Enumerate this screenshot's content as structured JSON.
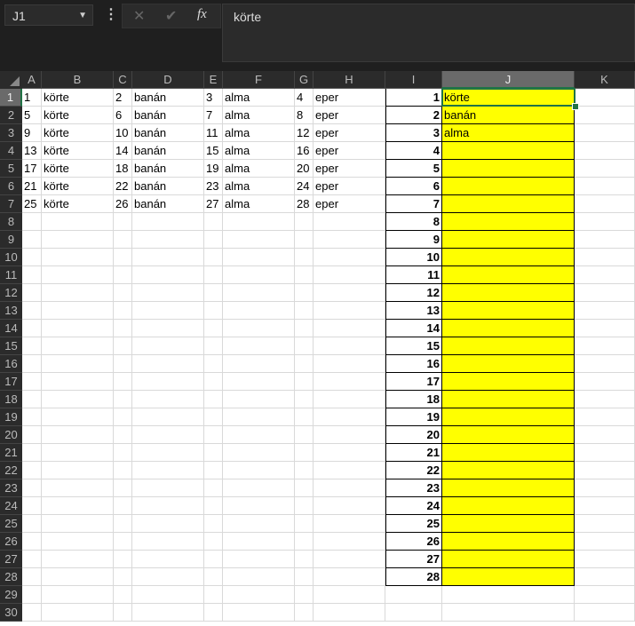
{
  "name_box": "J1",
  "formula": "körte",
  "formula_icons": [
    "cancel-icon",
    "enter-icon",
    "function-icon"
  ],
  "fx_label": "fx",
  "columns": [
    "A",
    "B",
    "C",
    "D",
    "E",
    "F",
    "G",
    "H",
    "I",
    "J",
    "K"
  ],
  "selected_column": "J",
  "selected_row": 1,
  "row_count": 30,
  "grid": [
    [
      "1",
      "körte",
      "2",
      "banán",
      "3",
      "alma",
      "4",
      "eper"
    ],
    [
      "5",
      "körte",
      "6",
      "banán",
      "7",
      "alma",
      "8",
      "eper"
    ],
    [
      "9",
      "körte",
      "10",
      "banán",
      "11",
      "alma",
      "12",
      "eper"
    ],
    [
      "13",
      "körte",
      "14",
      "banán",
      "15",
      "alma",
      "16",
      "eper"
    ],
    [
      "17",
      "körte",
      "18",
      "banán",
      "19",
      "alma",
      "20",
      "eper"
    ],
    [
      "21",
      "körte",
      "22",
      "banán",
      "23",
      "alma",
      "24",
      "eper"
    ],
    [
      "25",
      "körte",
      "26",
      "banán",
      "27",
      "alma",
      "28",
      "eper"
    ]
  ],
  "col_I": [
    "1",
    "2",
    "3",
    "4",
    "5",
    "6",
    "7",
    "8",
    "9",
    "10",
    "11",
    "12",
    "13",
    "14",
    "15",
    "16",
    "17",
    "18",
    "19",
    "20",
    "21",
    "22",
    "23",
    "24",
    "25",
    "26",
    "27",
    "28"
  ],
  "col_J": [
    "körte",
    "banán",
    "alma"
  ],
  "colors": {
    "highlight": "#ffff00",
    "accent": "#217346"
  }
}
